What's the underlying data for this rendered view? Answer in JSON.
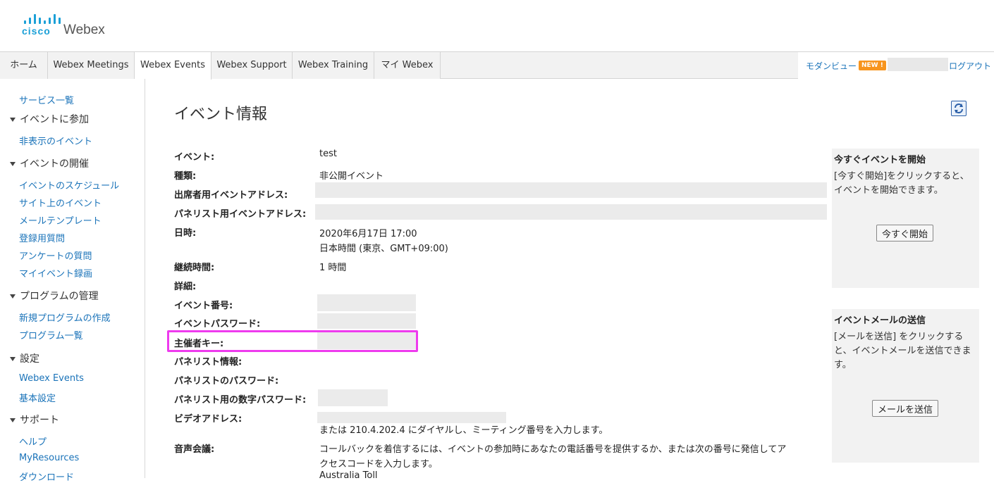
{
  "brand": {
    "cisco": "cisco",
    "product": "Webex"
  },
  "tabs": [
    {
      "label": "ホーム"
    },
    {
      "label": "Webex Meetings"
    },
    {
      "label": "Webex Events"
    },
    {
      "label": "Webex Support"
    },
    {
      "label": "Webex Training"
    },
    {
      "label": "マイ Webex"
    }
  ],
  "top_right": {
    "modern_view": "モダンビュー",
    "new_badge": "NEW !",
    "logout": "ログアウト"
  },
  "sidebar": {
    "service_list": "サービス一覧",
    "join_head": "イベントに参加",
    "hidden_events": "非表示のイベント",
    "host_head": "イベントの開催",
    "host_items": [
      "イベントのスケジュール",
      "サイト上のイベント",
      "メールテンプレート",
      "登録用質問",
      "アンケートの質問",
      "マイイベント録画"
    ],
    "program_head": "プログラムの管理",
    "program_items": [
      "新規プログラムの作成",
      "プログラム一覧"
    ],
    "settings_head": "設定",
    "settings_items": [
      "Webex Events",
      "基本設定"
    ],
    "support_head": "サポート",
    "support_items": [
      "ヘルプ",
      "MyResources",
      "ダウンロード"
    ]
  },
  "main": {
    "title": "イベント情報",
    "fields": {
      "event_label": "イベント:",
      "event_value": "test",
      "type_label": "種類:",
      "type_value": "非公開イベント",
      "attendee_addr_label": "出席者用イベントアドレス:",
      "panelist_addr_label": "パネリスト用イベントアドレス:",
      "datetime_label": "日時:",
      "datetime_value1": "2020年6月17日 17:00",
      "datetime_value2": "日本時間 (東京、GMT+09:00)",
      "duration_label": "継続時間:",
      "duration_value": "1 時間",
      "details_label": "詳細:",
      "event_number_label": "イベント番号:",
      "event_password_label": "イベントパスワード:",
      "host_key_label": "主催者キー:",
      "panelist_info_label": "パネリスト情報:",
      "panelist_password_label": "パネリストのパスワード:",
      "panelist_numeric_password_label": "パネリスト用の数字パスワード:",
      "video_address_label": "ビデオアドレス:",
      "video_address_note": "または 210.4.202.4 にダイヤルし、ミーティング番号を入力します。",
      "audio_label": "音声会議:",
      "audio_value1": "コールバックを着信するには、イベントの参加時にあなたの電話番号を提供するか、または次の番号に発信してア",
      "audio_value2": "クセスコードを入力します。",
      "audio_value3": "Australia Toll"
    }
  },
  "panels": {
    "start": {
      "title": "今すぐイベントを開始",
      "text": "[今すぐ開始]をクリックすると、イベントを開始できます。",
      "button": "今すぐ開始"
    },
    "mail": {
      "title": "イベントメールの送信",
      "text": "[メールを送信] をクリックすると、イベントメールを送信できます。",
      "button": "メールを送信"
    }
  },
  "colors": {
    "link": "#1a73b9",
    "brand": "#1ba0d7",
    "badge": "#f7941d",
    "highlight": "#ee3bee"
  }
}
